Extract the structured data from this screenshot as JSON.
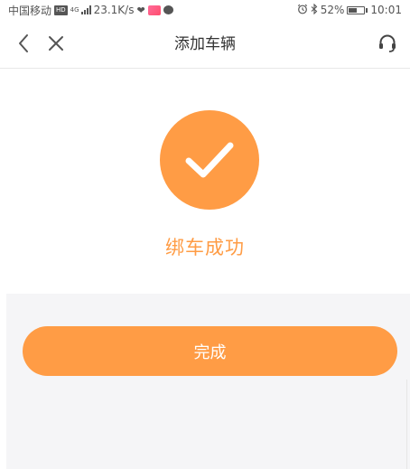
{
  "status_bar": {
    "carrier": "中国移动",
    "hd_badge": "HD",
    "network": "4G",
    "speed": "23.1K/s",
    "battery_percent": "52%",
    "battery_level": 0.52,
    "time": "10:01"
  },
  "nav": {
    "title": "添加车辆",
    "icons": [
      "back-icon",
      "close-icon",
      "customer-service-icon"
    ]
  },
  "success": {
    "icon": "checkmark-icon",
    "message": "绑车成功"
  },
  "actions": {
    "done_label": "完成"
  },
  "colors": {
    "accent": "#ff9c45",
    "title_text": "#333333",
    "status_text": "#555555",
    "bottom_background": "#f5f5f7"
  }
}
